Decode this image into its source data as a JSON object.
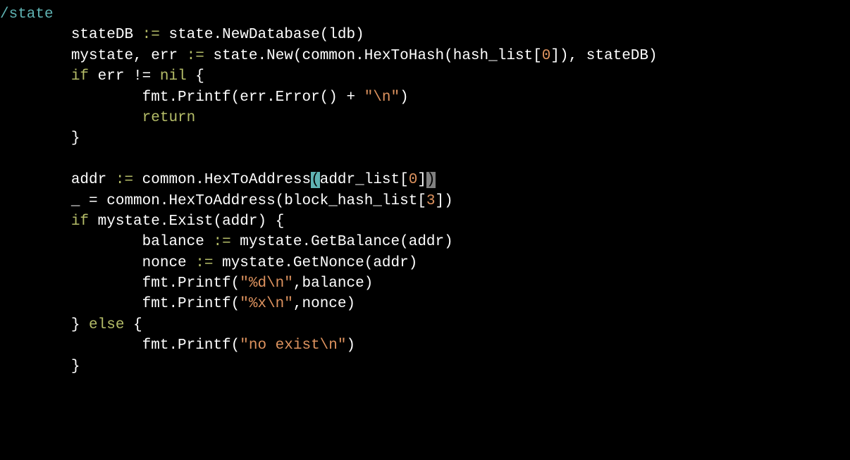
{
  "status": {
    "path": "/state"
  },
  "code": {
    "l1": {
      "a": "stateDB ",
      "b": ":=",
      "c": " state.NewDatabase(ldb)"
    },
    "l2": {
      "a": "mystate, err ",
      "b": ":=",
      "c": " state.New(common.HexToHash(hash_list[",
      "d": "0",
      "e": "]), stateDB)"
    },
    "l3": {
      "a": "if",
      "b": " err != ",
      "c": "nil",
      "d": " {"
    },
    "l4": {
      "a": "fmt.Printf(err.Error() + ",
      "b": "\"\\n\"",
      "c": ")"
    },
    "l5": {
      "a": "return"
    },
    "l6": {
      "a": "}"
    },
    "l8": {
      "a": "addr ",
      "b": ":=",
      "c": " common.HexToAddress",
      "d": "(",
      "e": "addr_list[",
      "f": "0",
      "g": "]",
      "h": ")"
    },
    "l9": {
      "a": "_ = common.HexToAddress(block_hash_list[",
      "b": "3",
      "c": "])"
    },
    "l10": {
      "a": "if",
      "b": " mystate.Exist(addr) {"
    },
    "l11": {
      "a": "balance ",
      "b": ":=",
      "c": " mystate.GetBalance(addr)"
    },
    "l12": {
      "a": "nonce ",
      "b": ":=",
      "c": " mystate.GetNonce(addr)"
    },
    "l13": {
      "a": "fmt.Printf(",
      "b": "\"%d\\n\"",
      "c": ",balance)"
    },
    "l14": {
      "a": "fmt.Printf(",
      "b": "\"%x\\n\"",
      "c": ",nonce)"
    },
    "l15": {
      "a": "} ",
      "b": "else",
      "c": " {"
    },
    "l16": {
      "a": "fmt.Printf(",
      "b": "\"no exist\\n\"",
      "c": ")"
    },
    "l17": {
      "a": "}"
    }
  }
}
